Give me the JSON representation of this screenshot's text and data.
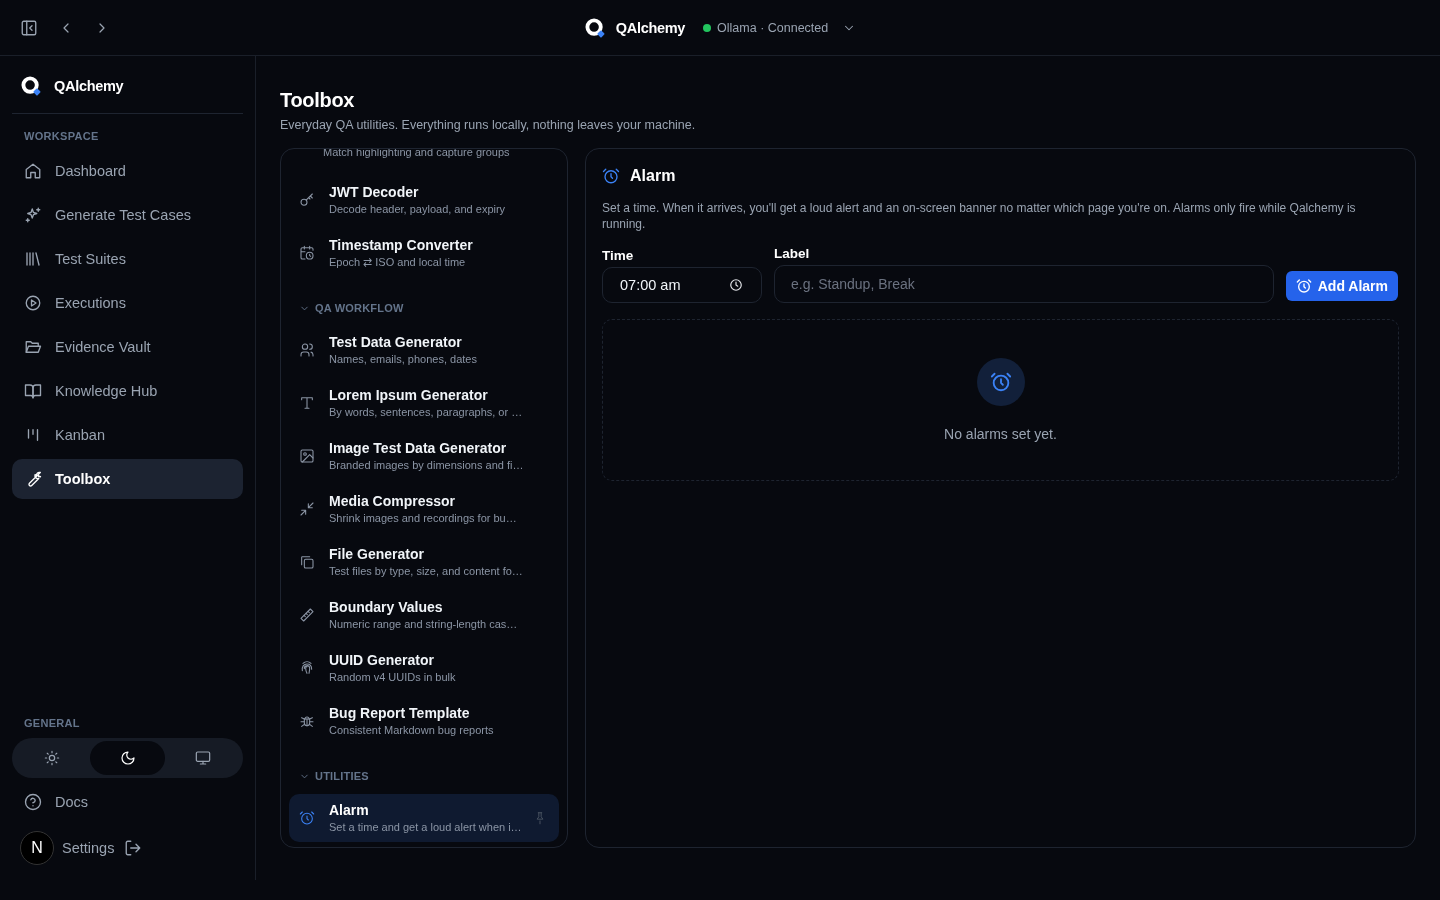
{
  "topbar": {
    "brand": "QAlchemy",
    "status": "Ollama · Connected"
  },
  "sidebar": {
    "brand": "QAlchemy",
    "workspace": {
      "title": "WORKSPACE",
      "items": [
        {
          "label": "Dashboard",
          "selected": false
        },
        {
          "label": "Generate Test Cases",
          "selected": false
        },
        {
          "label": "Test Suites",
          "selected": false
        },
        {
          "label": "Executions",
          "selected": false
        },
        {
          "label": "Evidence Vault",
          "selected": false
        },
        {
          "label": "Knowledge Hub",
          "selected": false
        },
        {
          "label": "Kanban",
          "selected": false
        },
        {
          "label": "Toolbox",
          "selected": true
        }
      ]
    },
    "general": {
      "title": "GENERAL",
      "themes": [
        {
          "selected": false
        },
        {
          "selected": true
        },
        {
          "selected": false
        }
      ],
      "items": [
        {
          "label": "Docs"
        },
        {
          "label": "Settings"
        }
      ],
      "avatar": "N"
    }
  },
  "page": {
    "title": "Toolbox",
    "subtitle": "Everyday QA utilities. Everything runs locally, nothing leaves your machine."
  },
  "tools": {
    "partial_description": "Match highlighting and capture groups",
    "groups": [
      {
        "items": [
          {
            "name": "JWT Decoder",
            "description": "Decode header, payload, and expiry",
            "selected": false
          },
          {
            "name": "Timestamp Converter",
            "description": "Epoch ⇄ ISO and local time",
            "selected": false
          }
        ]
      },
      {
        "title": "QA WORKFLOW",
        "expanded": true,
        "items": [
          {
            "name": "Test Data Generator",
            "description": "Names, emails, phones, dates",
            "selected": false
          },
          {
            "name": "Lorem Ipsum Generator",
            "description": "By words, sentences, paragraphs, or …",
            "selected": false
          },
          {
            "name": "Image Test Data Generator",
            "description": "Branded images by dimensions and fi…",
            "selected": false
          },
          {
            "name": "Media Compressor",
            "description": "Shrink images and recordings for bu…",
            "selected": false
          },
          {
            "name": "File Generator",
            "description": "Test files by type, size, and content fo…",
            "selected": false
          },
          {
            "name": "Boundary Values",
            "description": "Numeric range and string-length cas…",
            "selected": false
          },
          {
            "name": "UUID Generator",
            "description": "Random v4 UUIDs in bulk",
            "selected": false
          },
          {
            "name": "Bug Report Template",
            "description": "Consistent Markdown bug reports",
            "selected": false
          }
        ]
      },
      {
        "title": "UTILITIES",
        "expanded": true,
        "items": [
          {
            "name": "Alarm",
            "description": "Set a time and get a loud alert when i…",
            "selected": true
          }
        ]
      }
    ]
  },
  "alarm": {
    "title": "Alarm",
    "description": "Set a time. When it arrives, you'll get a loud alert and an on-screen banner no matter which page you're on. Alarms only fire while Qalchemy is running.",
    "time_label": "Time",
    "time_value": "07:00 am",
    "label_label": "Label",
    "label_placeholder": "e.g. Standup, Break",
    "button": "Add Alarm",
    "empty": "No alarms set yet."
  }
}
